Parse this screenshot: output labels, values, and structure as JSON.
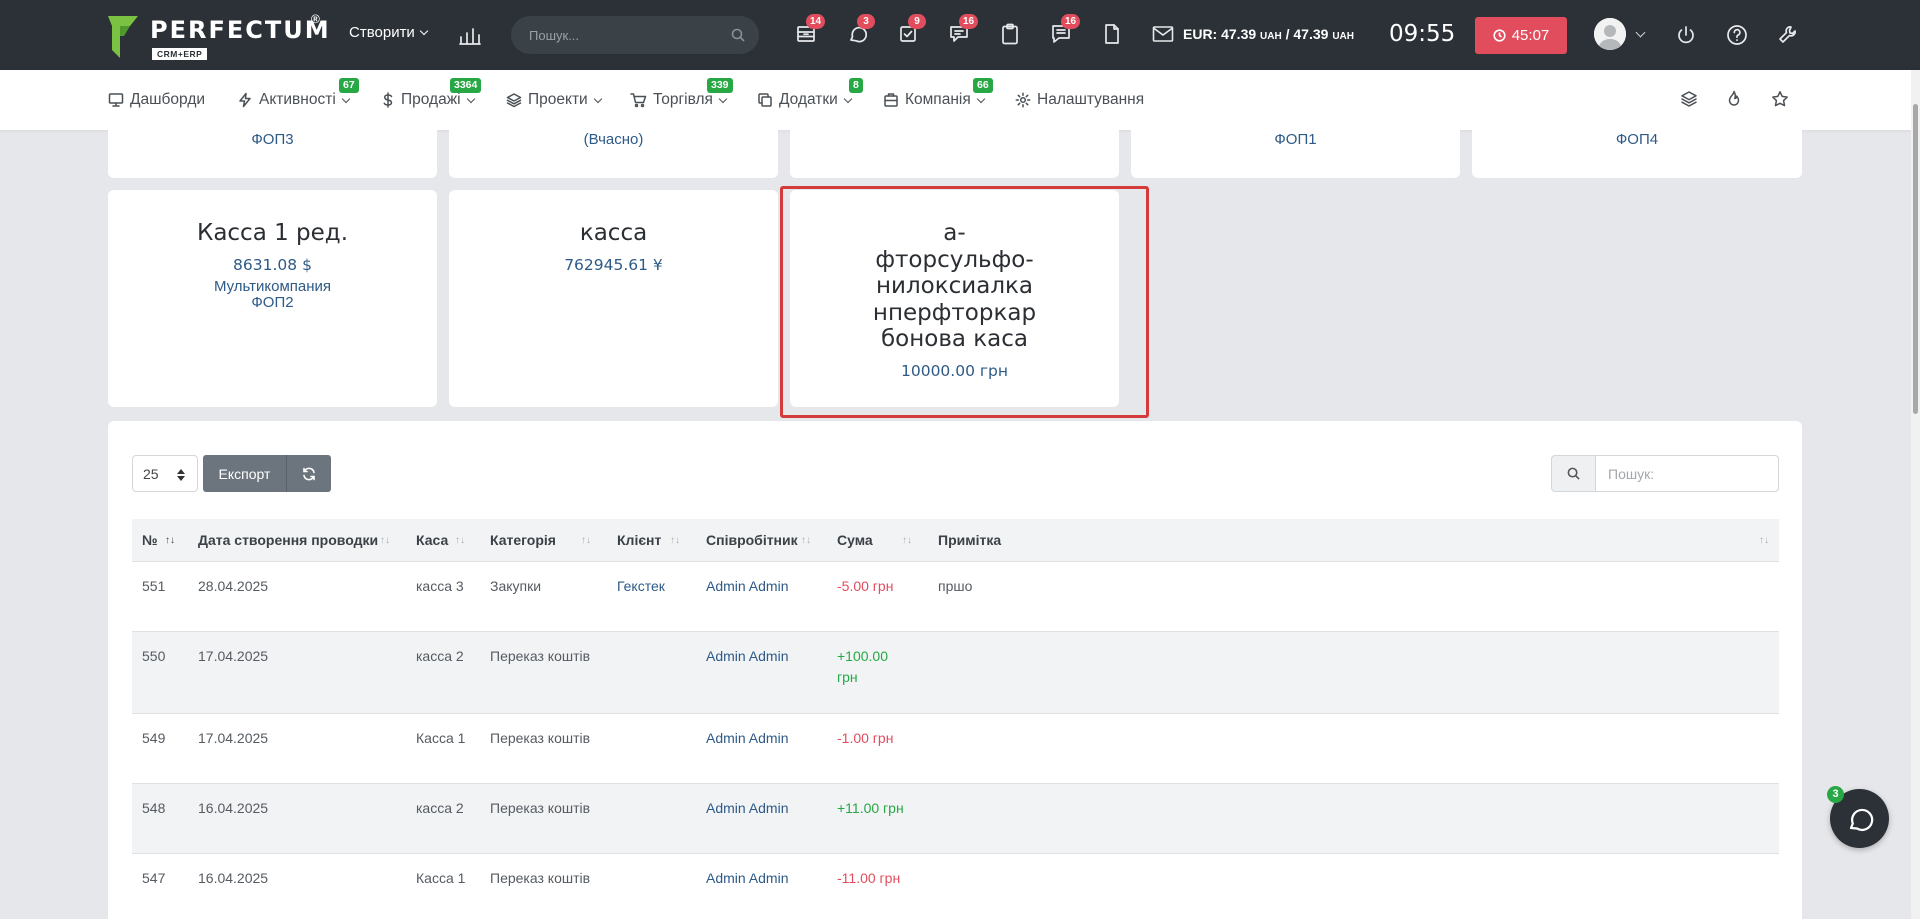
{
  "topbar": {
    "logo_name": "PERFECTUM",
    "logo_reg": "®",
    "logo_sub": "CRM+ERP",
    "create_label": "Створити",
    "search_placeholder": "Пошук...",
    "badges": [
      "14",
      "3",
      "9",
      "16",
      "16"
    ],
    "rate_label": "EUR: 47.39",
    "rate_uah": "UAH",
    "rate_sep": " / 47.39",
    "rate_uah2": "UAH",
    "clock": "09:55",
    "timer": "45:07",
    "accent": "#e24d5e"
  },
  "nav": {
    "items": [
      {
        "label": "Дашборди",
        "icon": "monitor-icon"
      },
      {
        "label": "Активності",
        "badge": "67",
        "icon": "bolt-icon"
      },
      {
        "label": "Продажі",
        "badge": "3364",
        "icon": "dollar-icon"
      },
      {
        "label": "Проекти",
        "icon": "layers-icon"
      },
      {
        "label": "Торгівля",
        "badge": "339",
        "icon": "cart-icon"
      },
      {
        "label": "Додатки",
        "badge": "8",
        "icon": "copy-icon"
      },
      {
        "label": "Компанія",
        "badge": "66",
        "icon": "building-icon"
      },
      {
        "label": "Налаштування",
        "icon": "gear-icon"
      }
    ],
    "badge_color": "#28a745"
  },
  "cards_top": [
    {
      "sub": "ФОП3"
    },
    {
      "sub": "(Вчасно)"
    },
    {
      "sub": ""
    },
    {
      "sub": "ФОП1"
    },
    {
      "sub": "ФОП4"
    }
  ],
  "cards": [
    {
      "title": "Касса 1 ред.",
      "balance": "8631.08 $",
      "org": "Мультикомпания ФОП2"
    },
    {
      "title": "касса",
      "balance": "762945.61 ¥"
    },
    {
      "title_lines": [
        "а-",
        "фторсульфо-",
        "нилоксиалка",
        "нперфторкар",
        "бонова каса"
      ],
      "balance": "10000.00 грн"
    }
  ],
  "table": {
    "page_length": "25",
    "export_label": "Експорт",
    "search_placeholder": "Пошук:",
    "columns": [
      "№",
      "Дата створення проводки",
      "Каса",
      "Категорія",
      "Клієнт",
      "Співробітник",
      "Сума",
      "Примітка"
    ],
    "rows": [
      {
        "id": "551",
        "date": "28.04.2025",
        "cash": "касса 3",
        "category": "Закупки",
        "client": "Гекстек",
        "employee": "Admin Admin",
        "sum": "-5.00 грн",
        "note": "пршо"
      },
      {
        "id": "550",
        "date": "17.04.2025",
        "cash": "касса 2",
        "category": "Переказ коштів",
        "client": "",
        "employee": "Admin Admin",
        "sum": "+100.00 грн",
        "note": ""
      },
      {
        "id": "549",
        "date": "17.04.2025",
        "cash": "Касса 1",
        "category": "Переказ коштів",
        "client": "",
        "employee": "Admin Admin",
        "sum": "-1.00 грн",
        "note": ""
      },
      {
        "id": "548",
        "date": "16.04.2025",
        "cash": "касса 2",
        "category": "Переказ коштів",
        "client": "",
        "employee": "Admin Admin",
        "sum": "+11.00 грн",
        "note": ""
      },
      {
        "id": "547",
        "date": "16.04.2025",
        "cash": "Касса 1",
        "category": "Переказ коштів",
        "client": "",
        "employee": "Admin Admin",
        "sum": "-11.00 грн",
        "note": ""
      }
    ]
  },
  "chat": {
    "badge": "3"
  }
}
